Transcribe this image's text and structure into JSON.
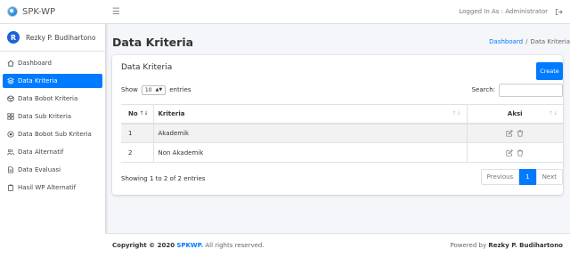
{
  "brand": {
    "name": "SPK-WP"
  },
  "user": {
    "initial": "R",
    "name": "Rezky P. Budihartono"
  },
  "sidebar": {
    "items": [
      {
        "label": "Dashboard",
        "icon": "home-icon"
      },
      {
        "label": "Data Kriteria",
        "icon": "layers-icon",
        "active": true
      },
      {
        "label": "Data Bobot Kriteria",
        "icon": "box-icon"
      },
      {
        "label": "Data Sub Kriteria",
        "icon": "grid-icon"
      },
      {
        "label": "Data Bobot Sub Kriteria",
        "icon": "target-icon"
      },
      {
        "label": "Data Alternatif",
        "icon": "users-icon"
      },
      {
        "label": "Data Evaluasi",
        "icon": "file-icon"
      },
      {
        "label": "Hasil WP Alternatif",
        "icon": "clipboard-icon"
      }
    ]
  },
  "topbar": {
    "logged_in": "Logged In As : Administrator"
  },
  "header": {
    "title": "Data Kriteria",
    "breadcrumb": {
      "home": "Dashboard",
      "separator": "/",
      "current": "Data Kriteria"
    }
  },
  "card": {
    "title": "Data Kriteria",
    "create_label": "Create",
    "show_label": "Show",
    "entries_value": "10",
    "entries_label": "entries",
    "search_label": "Search:",
    "search_value": "",
    "columns": {
      "no": "No",
      "kriteria": "Kriteria",
      "aksi": "Aksi"
    },
    "rows": [
      {
        "no": "1",
        "kriteria": "Akademik"
      },
      {
        "no": "2",
        "kriteria": "Non Akademik"
      }
    ],
    "info": "Showing 1 to 2 of 2 entries",
    "pagination": {
      "previous": "Previous",
      "current": "1",
      "next": "Next"
    }
  },
  "footer": {
    "copyright_prefix": "Copyright © 2020",
    "copyright_brand": "SPKWP.",
    "copyright_suffix": "All rights reserved.",
    "powered_prefix": "Powered by",
    "powered_name": "Rezky P. Budihartono"
  },
  "colors": {
    "accent": "#007bff",
    "background": "#f4f6f9"
  }
}
